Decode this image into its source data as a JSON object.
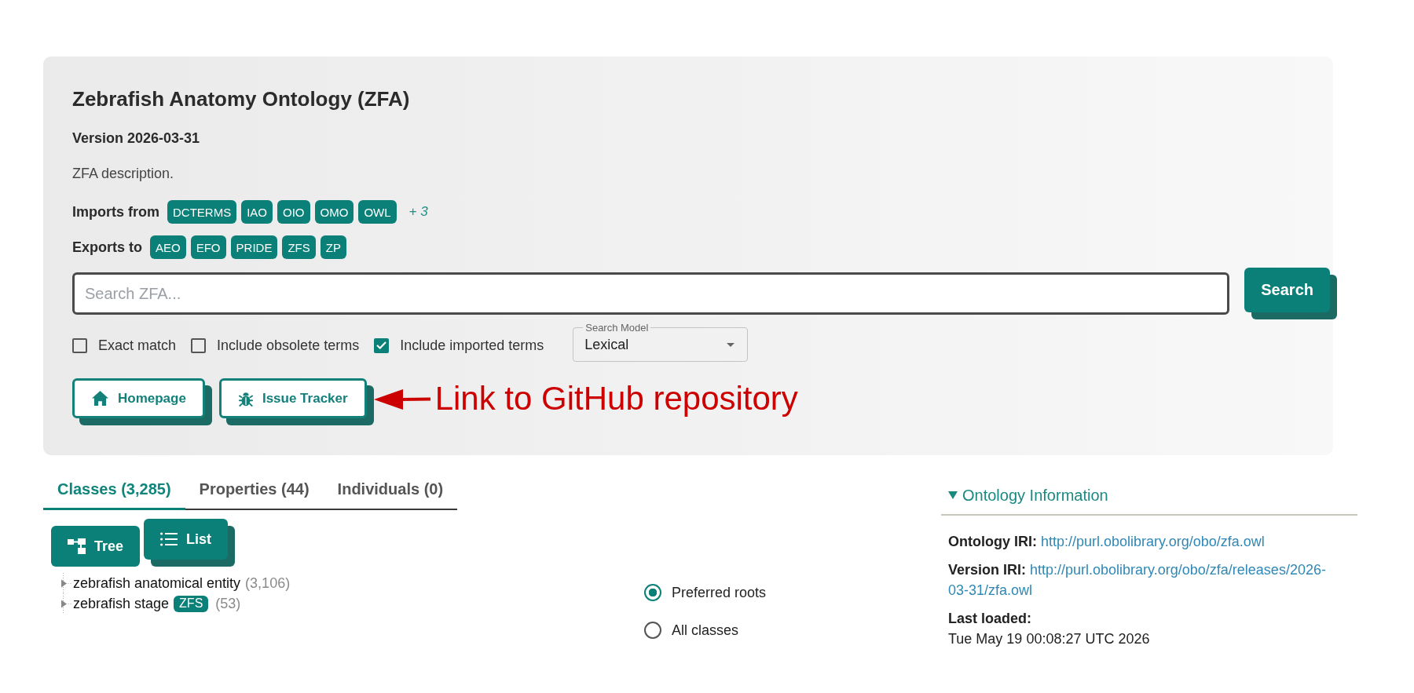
{
  "header": {
    "title": "Zebrafish Anatomy Ontology (ZFA)",
    "version": "Version 2026-03-31",
    "description": "ZFA description.",
    "imports": {
      "label": "Imports from",
      "tags": [
        "DCTERMS",
        "IAO",
        "OIO",
        "OMO",
        "OWL"
      ],
      "more": "+ 3"
    },
    "exports": {
      "label": "Exports to",
      "tags": [
        "AEO",
        "EFO",
        "PRIDE",
        "ZFS",
        "ZP"
      ]
    },
    "search": {
      "placeholder": "Search ZFA...",
      "button": "Search"
    },
    "options": [
      {
        "label": "Exact match",
        "checked": false
      },
      {
        "label": "Include obsolete terms",
        "checked": false
      },
      {
        "label": "Include imported terms",
        "checked": true
      }
    ],
    "search_model": {
      "label": "Search Model",
      "value": "Lexical"
    },
    "links": [
      "Homepage",
      "Issue Tracker"
    ]
  },
  "annotation": {
    "text": "Link to GitHub repository"
  },
  "tabs": [
    {
      "label": "Classes (3,285)",
      "selected": true
    },
    {
      "label": "Properties (44)",
      "selected": false
    },
    {
      "label": "Individuals (0)",
      "selected": false
    }
  ],
  "view_modes": [
    {
      "label": "Tree",
      "selected": true
    },
    {
      "label": "List",
      "selected": false
    }
  ],
  "tree": [
    {
      "label": "zebrafish anatomical entity",
      "count": "(3,106)",
      "expanded": false
    },
    {
      "label": "zebrafish stage",
      "tag": "ZFS",
      "count": "(53)",
      "expanded": false
    }
  ],
  "root_options": [
    {
      "label": "Preferred roots",
      "selected": true
    },
    {
      "label": "All classes",
      "selected": false
    }
  ],
  "ontology_info": {
    "title": "Ontology Information",
    "expanded": true,
    "fields": [
      {
        "kind": "link",
        "label": "Ontology IRI:",
        "value": "http://purl.obolibrary.org/obo/zfa.owl"
      },
      {
        "kind": "link",
        "label": "Version IRI:",
        "value": "http://purl.obolibrary.org/obo/zfa/releases/2026-03-31/zfa.owl"
      },
      {
        "kind": "text",
        "label": "Last loaded:",
        "value": "Tue May 19 00:08:27 UTC 2026"
      }
    ]
  }
}
